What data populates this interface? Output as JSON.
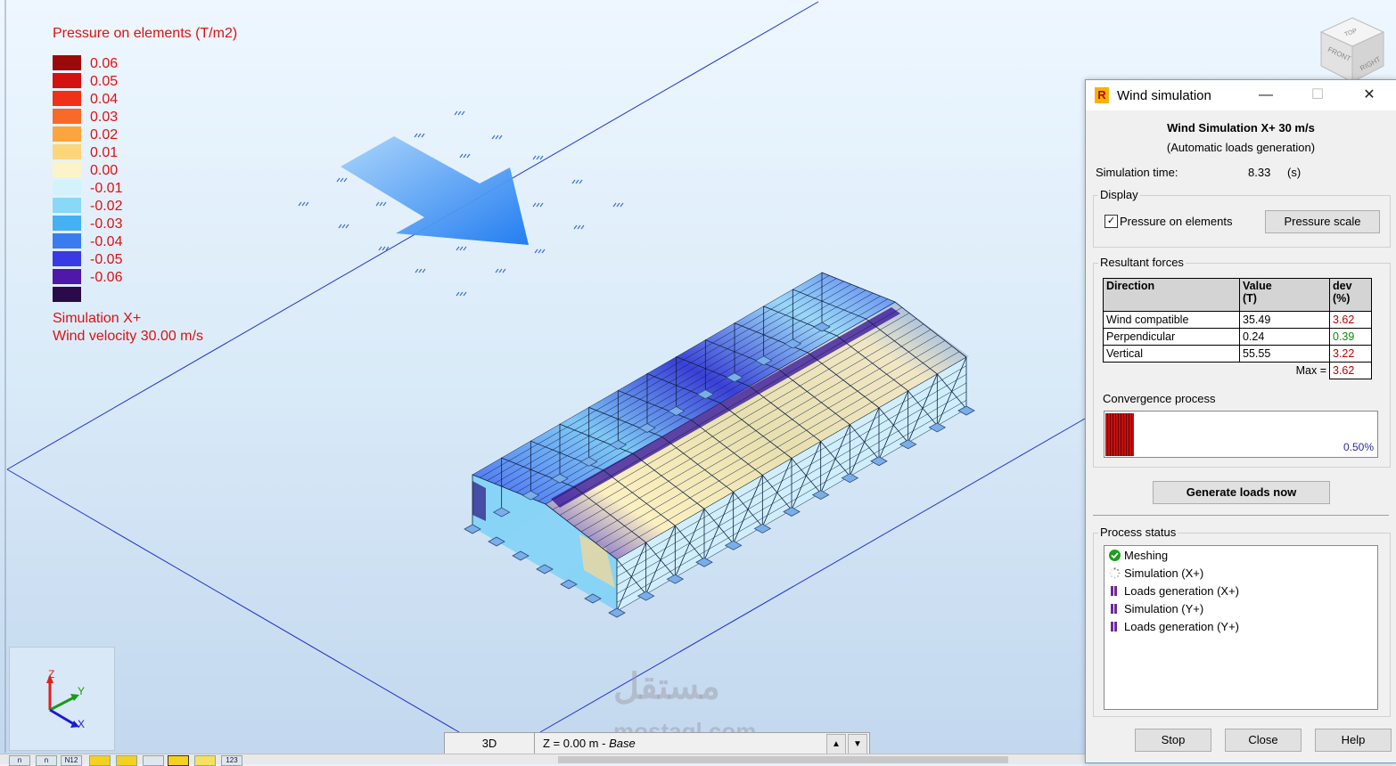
{
  "legend": {
    "title": "Pressure on elements (T/m2)",
    "items": [
      {
        "value": "0.06",
        "color": "#9b0a0a"
      },
      {
        "value": "0.05",
        "color": "#d41010"
      },
      {
        "value": "0.04",
        "color": "#f03018"
      },
      {
        "value": "0.03",
        "color": "#f86a28"
      },
      {
        "value": "0.02",
        "color": "#fca53c"
      },
      {
        "value": "0.01",
        "color": "#fdd67a"
      },
      {
        "value": "0.00",
        "color": "#fdf3c8"
      },
      {
        "value": "-0.01",
        "color": "#d4f2fb"
      },
      {
        "value": "-0.02",
        "color": "#88d8f8"
      },
      {
        "value": "-0.03",
        "color": "#45b0f2"
      },
      {
        "value": "-0.04",
        "color": "#3a7cf0"
      },
      {
        "value": "-0.05",
        "color": "#3a3ae4"
      },
      {
        "value": "-0.06",
        "color": "#5018a8"
      },
      {
        "value": "",
        "color": "#2a0a48"
      }
    ],
    "simulation_label": "Simulation X+",
    "wind_velocity": "Wind velocity 30.00 m/s"
  },
  "axes": {
    "z": "Z",
    "y": "Y",
    "x": "X"
  },
  "viewcube": {
    "top": "TOP",
    "front": "FRONT",
    "right": "RIGHT"
  },
  "statusbar": {
    "view_mode": "3D",
    "level_prefix": "Z = 0.00 m - ",
    "level_name": "Base",
    "up": "▲",
    "down": "▼"
  },
  "toolbar": {
    "icons": [
      "n",
      "n",
      "N12",
      "",
      "",
      "",
      "",
      "",
      "123"
    ]
  },
  "watermark": {
    "line1": "مستقل",
    "line2": "mostaql.com"
  },
  "dialog": {
    "title": "Wind simulation",
    "app_icon": "R",
    "heading": "Wind Simulation X+ 30 m/s",
    "subheading": "(Automatic loads generation)",
    "simulation_time_label": "Simulation time:",
    "simulation_time_value": "8.33",
    "simulation_time_unit": "(s)",
    "display_group": "Display",
    "pressure_checkbox_label": "Pressure on elements",
    "pressure_checked": true,
    "pressure_scale_button": "Pressure scale",
    "resultant_group": "Resultant forces",
    "table": {
      "headers": [
        "Direction",
        "Value",
        "(T)",
        "dev",
        "(%)"
      ],
      "rows": [
        {
          "direction": "Wind compatible",
          "value": "35.49",
          "dev": "3.62",
          "status": "red"
        },
        {
          "direction": "Perpendicular",
          "value": "0.24",
          "dev": "0.39",
          "status": "green"
        },
        {
          "direction": "Vertical",
          "value": "55.55",
          "dev": "3.22",
          "status": "red"
        }
      ],
      "max_label": "Max =",
      "max_value": "3.62"
    },
    "convergence_label": "Convergence process",
    "convergence_value": "0.50%",
    "generate_button": "Generate loads now",
    "process_group": "Process status",
    "process_items": [
      {
        "label": "Meshing",
        "state": "done"
      },
      {
        "label": "Simulation (X+)",
        "state": "running"
      },
      {
        "label": "Loads generation (X+)",
        "state": "pending"
      },
      {
        "label": "Simulation (Y+)",
        "state": "pending"
      },
      {
        "label": "Loads generation (Y+)",
        "state": "pending"
      }
    ],
    "stop_button": "Stop",
    "close_button": "Close",
    "help_button": "Help"
  }
}
